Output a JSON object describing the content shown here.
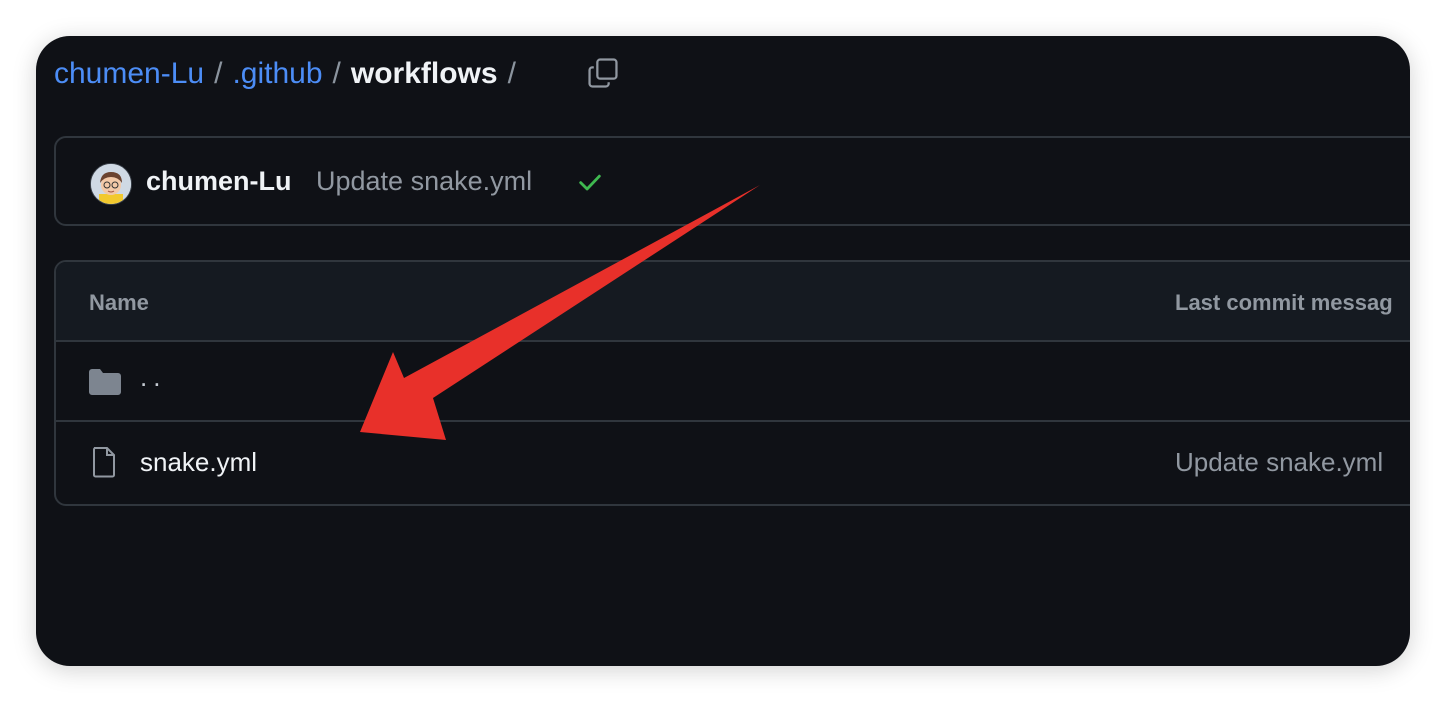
{
  "breadcrumb": {
    "owner": "chumen-Lu",
    "dir1": ".github",
    "current": "workflows",
    "separator": "/"
  },
  "latest_commit": {
    "author": "chumen-Lu",
    "message": "Update snake.yml",
    "status": "success",
    "status_color": "#3fb950"
  },
  "table": {
    "col_name": "Name",
    "col_commit": "Last commit messag",
    "rows": [
      {
        "type": "parent-dir",
        "name": "..",
        "commit": ""
      },
      {
        "type": "file",
        "name": "snake.yml",
        "commit": "Update snake.yml"
      }
    ]
  },
  "annotation": {
    "arrow_color": "#e8302a",
    "points_to": "snake.yml"
  },
  "colors": {
    "background": "#0f1116",
    "link": "#4c8df6",
    "border": "#30363d",
    "muted_text": "#9198a1"
  }
}
